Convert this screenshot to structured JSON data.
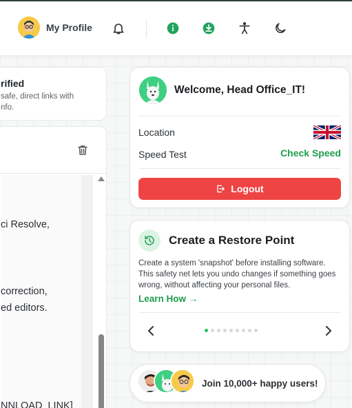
{
  "header": {
    "profile_label": "My Profile",
    "icons": [
      "bell-icon",
      "info-icon",
      "download-icon",
      "accessibility-icon",
      "moon-icon"
    ],
    "accent": "#22a45d"
  },
  "left": {
    "verified_title": "rified",
    "verified_desc_1": "safe, direct links with",
    "verified_desc_2": "nfo.",
    "doc_lines": [
      "ci Resolve,",
      "correction,",
      "ed editors.",
      "NNLOAD_LINK]"
    ]
  },
  "welcome": {
    "title": "Welcome, Head Office_IT!",
    "location_label": "Location",
    "speed_label": "Speed Test",
    "speed_action": "Check Speed",
    "logout_label": "Logout",
    "logout_color": "#ef4444"
  },
  "restore": {
    "title": "Create a Restore Point",
    "description": "Create a system 'snapshot' before installing software. This safety net lets you undo changes if something goes wrong, without affecting your personal files.",
    "link": "Learn How →",
    "slide_count": 9,
    "active_slide": 0
  },
  "join": {
    "text": "Join 10,000+ happy users!"
  }
}
